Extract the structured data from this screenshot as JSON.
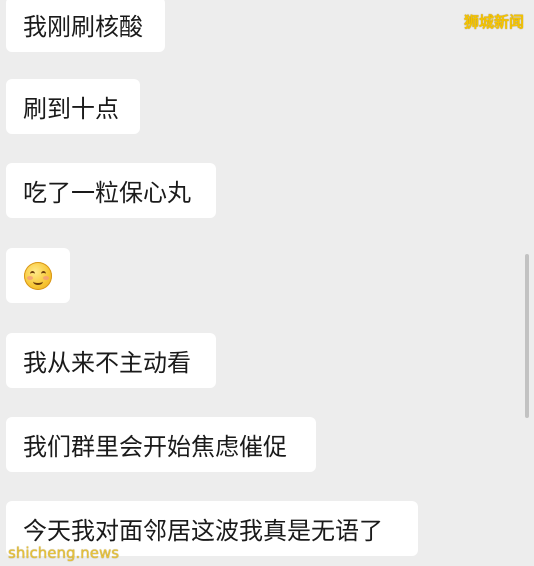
{
  "messages": [
    {
      "text": "我刚刷核酸"
    },
    {
      "text": "刷到十点"
    },
    {
      "text": "吃了一粒保心丸"
    },
    {
      "emoji": "smiling-face-emoji"
    },
    {
      "text": "我从来不主动看"
    },
    {
      "text": "我们群里会开始焦虑催促"
    },
    {
      "text": "今天我对面邻居这波我真是无语了"
    }
  ],
  "watermarks": {
    "top_right": "狮城新闻",
    "bottom_left": "shicheng.news"
  },
  "colors": {
    "background": "#ededed",
    "bubble": "#ffffff",
    "watermark": "#f5c400"
  }
}
